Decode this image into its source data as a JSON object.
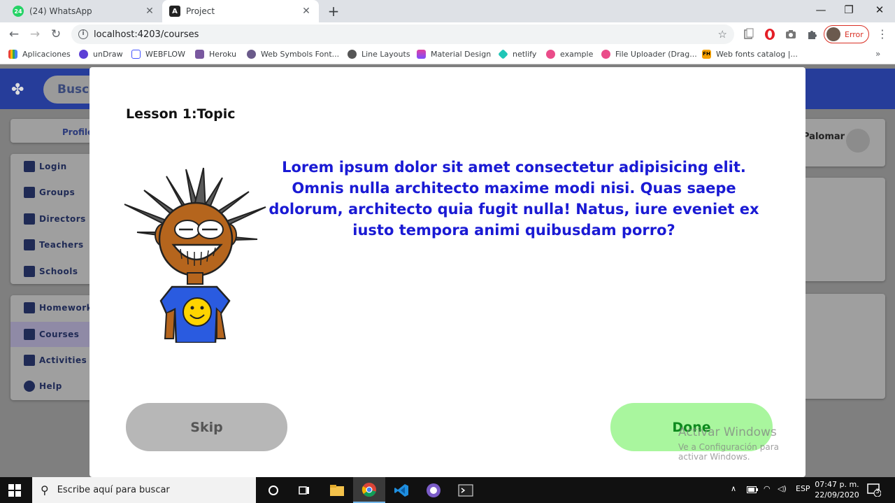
{
  "browser": {
    "tabs": [
      {
        "label": "(24) WhatsApp",
        "badge": "24"
      },
      {
        "label": "Project",
        "icon": "angular-icon"
      }
    ],
    "url": "localhost:4203/courses",
    "profile_status": "Error",
    "bookmarks": [
      "Aplicaciones",
      "unDraw",
      "WEBFLOW",
      "Heroku",
      "Web Symbols Font...",
      "Line Layouts",
      "Material Design",
      "netlify",
      "example",
      "File Uploader (Drag...",
      "Web fonts catalog |..."
    ]
  },
  "app": {
    "search_placeholder": "Busca",
    "profile_tab": "Profile",
    "user_name": "Palomar",
    "sidebar_top": [
      "Login",
      "Groups",
      "Directors",
      "Teachers",
      "Schools"
    ],
    "sidebar_bottom": [
      "Homework",
      "Courses",
      "Activities",
      "Help"
    ]
  },
  "modal": {
    "title": "Lesson 1:Topic",
    "body": "Lorem ipsum dolor sit amet consectetur adipisicing elit. Omnis nulla architecto maxime modi nisi. Quas saepe dolorum, architecto quia fugit nulla! Natus, iure eveniet ex iusto tempora animi quibusdam porro?",
    "skip_label": "Skip",
    "done_label": "Done"
  },
  "watermark": {
    "line1": "Activar Windows",
    "line2": "Ve a Configuración para activar Windows."
  },
  "taskbar": {
    "search_placeholder": "Escribe aquí para buscar",
    "lang": "ESP",
    "time": "07:47 p. m.",
    "date": "22/09/2020",
    "notifications": "3"
  },
  "colors": {
    "header": "#263d9a",
    "lesson_text": "#1a1ad4",
    "done_bg": "#a9f69e",
    "done_text": "#0d8a1d",
    "skip_bg": "#b7b7b7"
  }
}
